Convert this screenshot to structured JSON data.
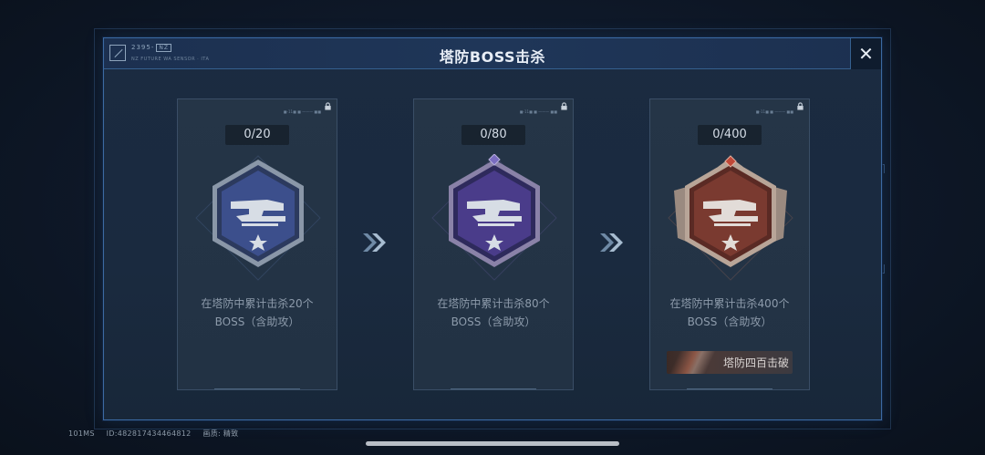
{
  "window": {
    "title": "塔防BOSS击杀",
    "logo_code": "2395-",
    "logo_tag": "NZ",
    "logo_sub": "NZ FUTURE WA SENSOR · ITA",
    "close_label": "✕"
  },
  "cards": [
    {
      "progress": "0/20",
      "serial": "■-11■ ■ ——— ■■",
      "desc_line1": "在塔防中累计击杀20个",
      "desc_line2": "BOSS（含助攻）",
      "badge_tier": "blue",
      "lock_icon": "lock-icon"
    },
    {
      "progress": "0/80",
      "serial": "■-11■ ■ ——— ■■",
      "desc_line1": "在塔防中累计击杀80个",
      "desc_line2": "BOSS（含助攻）",
      "badge_tier": "purple",
      "lock_icon": "lock-icon"
    },
    {
      "progress": "0/400",
      "serial": "■-11■ ■ ——— ■■",
      "desc_line1": "在塔防中累计击杀400个",
      "desc_line2": "BOSS（含助攻）",
      "badge_tier": "red",
      "lock_icon": "lock-icon",
      "reward_label": "塔防四百击破"
    }
  ],
  "footer": {
    "ping": "101MS",
    "id_text": "ID:482817434464812",
    "quality": "画质: 精致"
  },
  "colors": {
    "accent_border": "#3c6aa2",
    "badge_blue": "#3c4f8c",
    "badge_purple": "#4a3c8a",
    "badge_red": "#7a3a30"
  }
}
